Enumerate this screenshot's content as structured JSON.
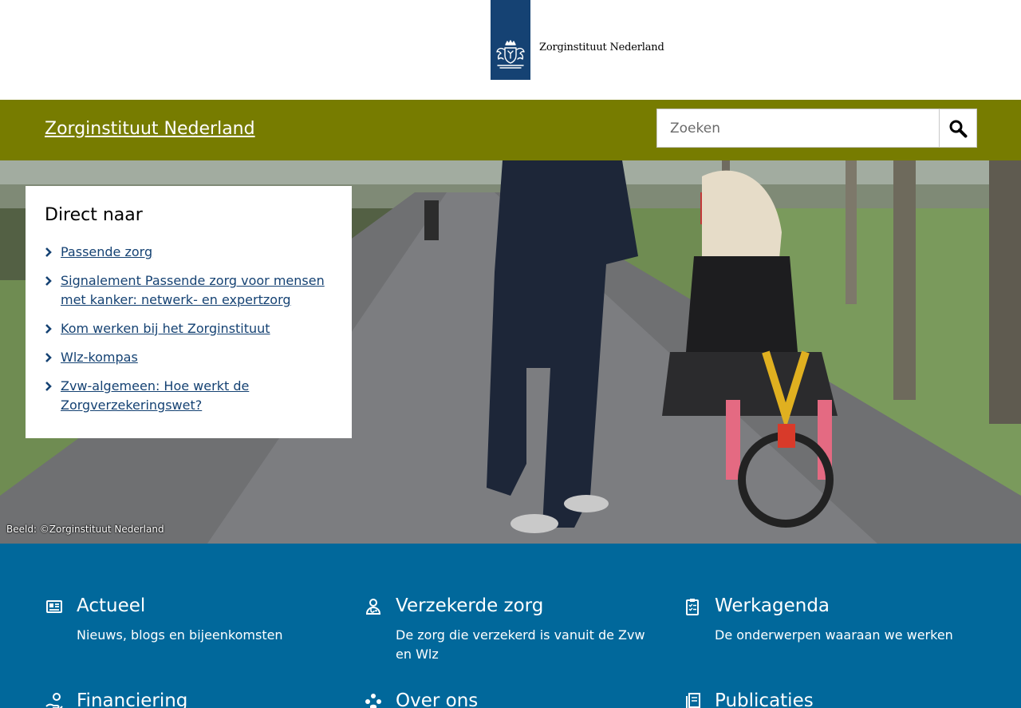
{
  "logo": {
    "text": "Zorginstituut Nederland",
    "ribbon_color": "#154273"
  },
  "header": {
    "site_title": "Zorginstituut Nederland",
    "bar_color": "#777c00",
    "search": {
      "placeholder": "Zoeken",
      "value": "",
      "button_icon": "search-icon"
    }
  },
  "hero": {
    "photo_credit": "Beeld: ©Zorginstituut Nederland",
    "direct_naar": {
      "title": "Direct naar",
      "items": [
        {
          "label": "Passende zorg"
        },
        {
          "label": "Signalement Passende zorg voor mensen met kanker: netwerk- en expertzorg"
        },
        {
          "label": "Kom werken bij het Zorginstituut"
        },
        {
          "label": "Wlz-kompas"
        },
        {
          "label": "Zvw-algemeen: Hoe werkt de Zorgverzekeringswet?"
        }
      ]
    }
  },
  "tiles": {
    "section_color": "#01689b",
    "items": [
      {
        "title": "Actueel",
        "description": "Nieuws, blogs en bijeenkomsten",
        "icon": "newspaper-icon"
      },
      {
        "title": "Verzekerde zorg",
        "description": "De zorg die verzekerd is vanuit de Zvw en Wlz",
        "icon": "doctor-icon"
      },
      {
        "title": "Werkagenda",
        "description": "De onderwerpen waaraan we werken",
        "icon": "clipboard-icon"
      },
      {
        "title": "Financiering",
        "description": "",
        "icon": "money-icon"
      },
      {
        "title": "Over ons",
        "description": "",
        "icon": "people-icon"
      },
      {
        "title": "Publicaties",
        "description": "",
        "icon": "publications-icon"
      }
    ]
  }
}
